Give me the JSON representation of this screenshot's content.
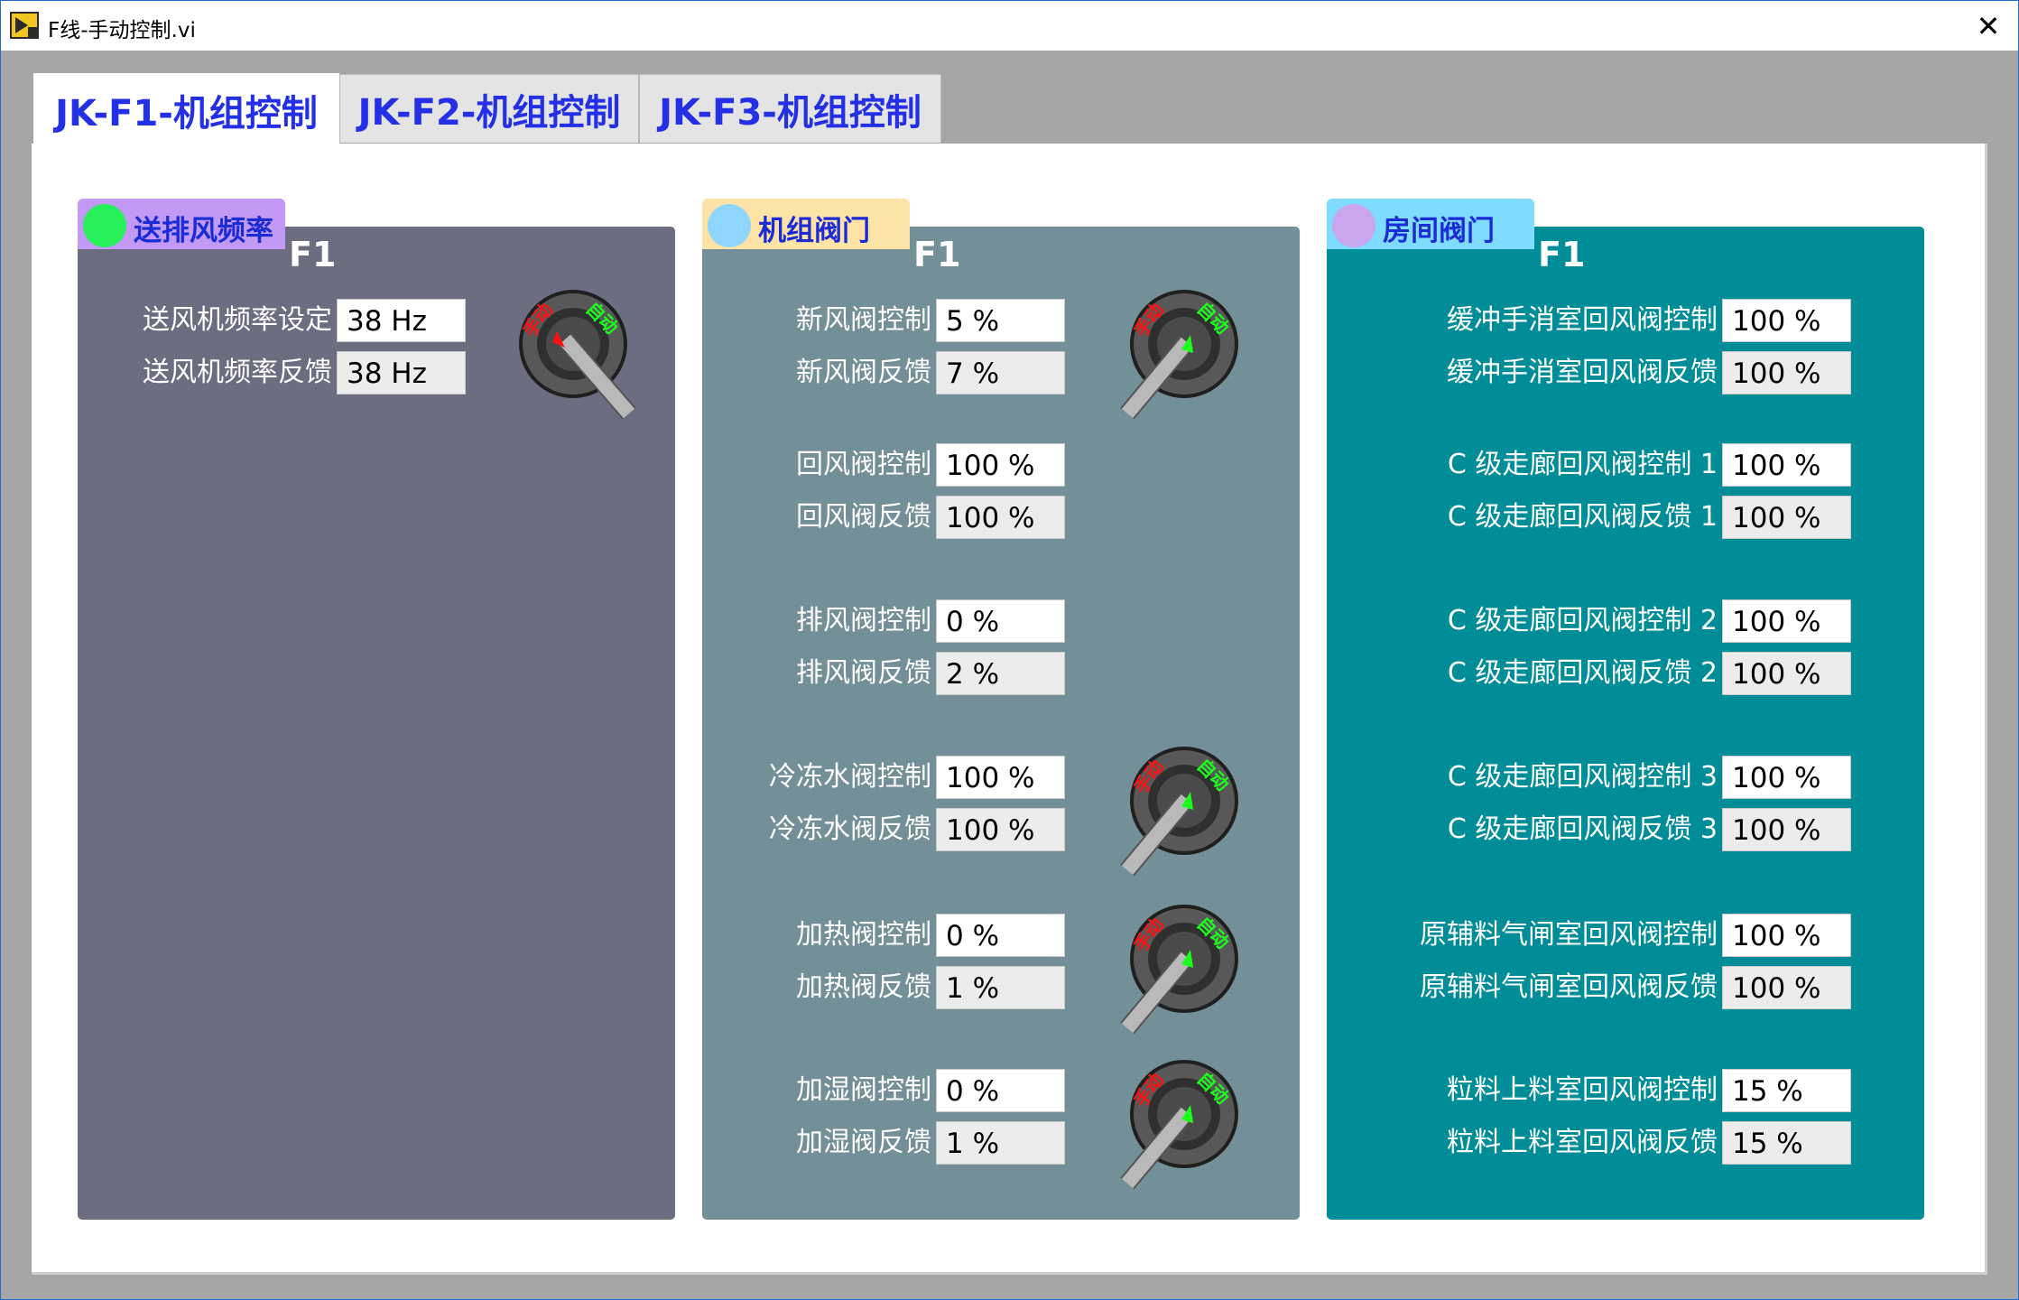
{
  "window": {
    "title": "F线-手动控制.vi",
    "close_glyph": "✕"
  },
  "tabs": [
    {
      "label": "JK-F1-机组控制",
      "active": true
    },
    {
      "label": "JK-F2-机组控制",
      "active": false
    },
    {
      "label": "JK-F3-机组控制",
      "active": false
    }
  ],
  "colors": {
    "tab_text": "#2330e6",
    "panel_fan": "#6d6d82",
    "panel_unit": "#738f97",
    "panel_room": "#008d98",
    "manual_red": "#ff1010",
    "auto_green": "#1aff1a"
  },
  "panels": [
    {
      "tag": "送排风频率",
      "tag_bg": "#c29af5",
      "dot_color": "#27f05a",
      "unit": "F1",
      "rows": [
        {
          "control_label": "送风机频率设定",
          "control_value": "38 Hz",
          "feedback_label": "送风机频率反馈",
          "feedback_value": "38 Hz",
          "switch": {
            "manual": "手动",
            "auto": "自动",
            "state": "manual"
          }
        }
      ]
    },
    {
      "tag": "机组阀门",
      "tag_bg": "#fde3a6",
      "dot_color": "#8fd6ff",
      "unit": "F1",
      "rows": [
        {
          "control_label": "新风阀控制",
          "control_value": "5 %",
          "feedback_label": "新风阀反馈",
          "feedback_value": "7 %",
          "switch": {
            "manual": "手动",
            "auto": "自动",
            "state": "auto"
          }
        },
        {
          "control_label": "回风阀控制",
          "control_value": "100 %",
          "feedback_label": "回风阀反馈",
          "feedback_value": "100 %"
        },
        {
          "control_label": "排风阀控制",
          "control_value": "0 %",
          "feedback_label": "排风阀反馈",
          "feedback_value": "2 %"
        },
        {
          "control_label": "冷冻水阀控制",
          "control_value": "100 %",
          "feedback_label": "冷冻水阀反馈",
          "feedback_value": "100 %",
          "switch": {
            "manual": "手动",
            "auto": "自动",
            "state": "auto"
          }
        },
        {
          "control_label": "加热阀控制",
          "control_value": "0 %",
          "feedback_label": "加热阀反馈",
          "feedback_value": "1 %",
          "switch": {
            "manual": "手动",
            "auto": "自动",
            "state": "auto"
          }
        },
        {
          "control_label": "加湿阀控制",
          "control_value": "0 %",
          "feedback_label": "加湿阀反馈",
          "feedback_value": "1 %",
          "switch": {
            "manual": "手动",
            "auto": "自动",
            "state": "auto"
          }
        }
      ]
    },
    {
      "tag": "房间阀门",
      "tag_bg": "#7fdcff",
      "dot_color": "#caa6ee",
      "unit": "F1",
      "rows": [
        {
          "control_label": "缓冲手消室回风阀控制",
          "control_value": "100 %",
          "feedback_label": "缓冲手消室回风阀反馈",
          "feedback_value": "100 %"
        },
        {
          "control_label": "C 级走廊回风阀控制 1",
          "control_value": "100 %",
          "feedback_label": "C 级走廊回风阀反馈 1",
          "feedback_value": "100 %"
        },
        {
          "control_label": "C 级走廊回风阀控制 2",
          "control_value": "100 %",
          "feedback_label": "C 级走廊回风阀反馈 2",
          "feedback_value": "100 %"
        },
        {
          "control_label": "C 级走廊回风阀控制 3",
          "control_value": "100 %",
          "feedback_label": "C 级走廊回风阀反馈 3",
          "feedback_value": "100 %"
        },
        {
          "control_label": "原辅料气闸室回风阀控制",
          "control_value": "100 %",
          "feedback_label": "原辅料气闸室回风阀反馈",
          "feedback_value": "100 %"
        },
        {
          "control_label": "粒料上料室回风阀控制",
          "control_value": "15 %",
          "feedback_label": "粒料上料室回风阀反馈",
          "feedback_value": "15 %"
        }
      ]
    }
  ]
}
